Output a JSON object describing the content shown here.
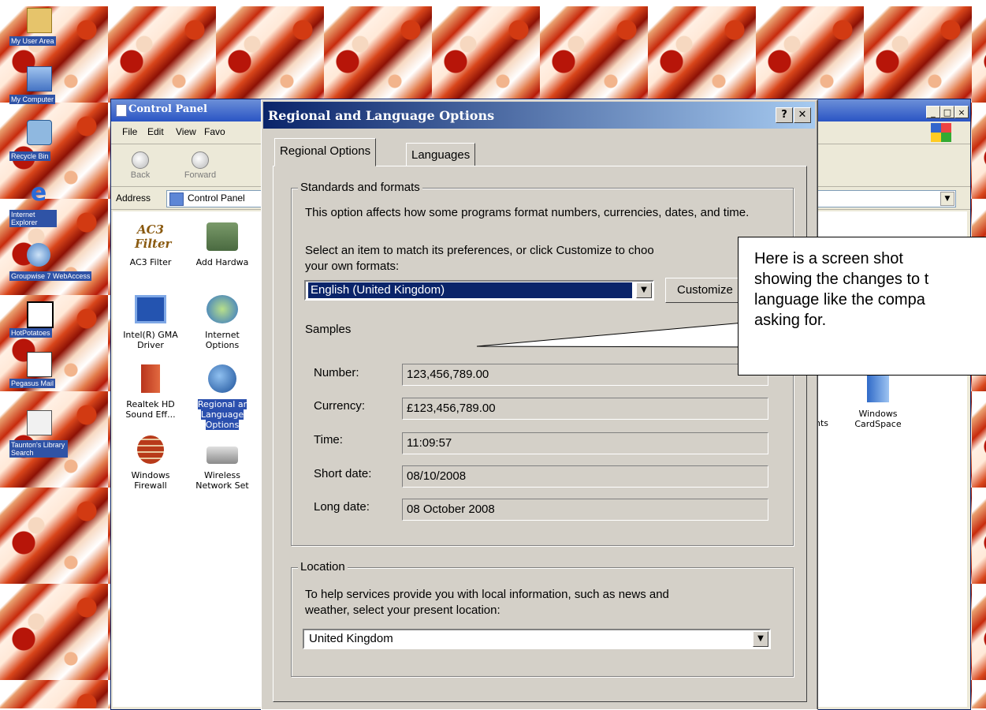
{
  "desktop": {
    "icons": [
      {
        "label": "My User Area",
        "icon": "folder-user-icon"
      },
      {
        "label": "My Computer",
        "icon": "computer-icon"
      },
      {
        "label": "Recycle Bin",
        "icon": "recycle-bin-icon"
      },
      {
        "label": "Internet Explorer",
        "icon": "internet-explorer-icon"
      },
      {
        "label": "Groupwise 7 WebAccess",
        "icon": "groupwise-icon"
      },
      {
        "label": "HotPotatoes",
        "icon": "hotpotatoes-icon"
      },
      {
        "label": "Pegasus Mail",
        "icon": "pegasus-mail-icon"
      },
      {
        "label": "Taunton's Library Search",
        "icon": "library-search-icon"
      }
    ]
  },
  "control_panel": {
    "title": "Control Panel",
    "menu": [
      "File",
      "Edit",
      "View",
      "Favo"
    ],
    "toolbar": {
      "back": "Back",
      "forward": "Forward"
    },
    "address_label": "Address",
    "address_value": "Control Panel",
    "items": [
      {
        "label": "AC3 Filter",
        "icon": "ac3-filter-icon"
      },
      {
        "label": "Add Hardwa",
        "icon": "add-hardware-icon"
      },
      {
        "label": "Intel(R) GMA Driver",
        "icon": "intel-gma-icon"
      },
      {
        "label": "Internet Options",
        "icon": "internet-options-icon"
      },
      {
        "label": "Realtek HD Sound Eff...",
        "icon": "speaker-icon"
      },
      {
        "label": "Regional ar Language Options",
        "icon": "globe-icon"
      },
      {
        "label": "Windows Firewall",
        "icon": "firewall-icon"
      },
      {
        "label": "Wireless Network Set",
        "icon": "wireless-icon"
      },
      {
        "label": "unts",
        "icon": ""
      },
      {
        "label": "Windows CardSpace",
        "icon": "cardspace-icon"
      }
    ]
  },
  "dialog": {
    "title": "Regional and Language Options",
    "help_button": "?",
    "close_button": "✕",
    "tabs": [
      "Regional Options",
      "Languages"
    ],
    "standards": {
      "caption": "Standards and formats",
      "description": "This option affects how some programs format numbers, currencies, dates, and time.",
      "select_text_line1": "Select an item to match its preferences, or click Customize to choo",
      "select_text_line2": "your own formats:",
      "selected_format": "English (United Kingdom)",
      "customize_button": "Customize"
    },
    "samples": {
      "caption": "Samples",
      "rows": [
        {
          "label": "Number:",
          "value": "123,456,789.00"
        },
        {
          "label": "Currency:",
          "value": "£123,456,789.00"
        },
        {
          "label": "Time:",
          "value": "11:09:57"
        },
        {
          "label": "Short date:",
          "value": "08/10/2008"
        },
        {
          "label": "Long date:",
          "value": "08 October 2008"
        }
      ]
    },
    "location": {
      "caption": "Location",
      "description_line1": "To help services provide you with local information, such as news and",
      "description_line2": "weather, select your present location:",
      "selected": "United Kingdom"
    }
  },
  "callout": {
    "text": "Here is a screen shot\nshowing the changes to t\nlanguage like the compa\nasking for."
  }
}
